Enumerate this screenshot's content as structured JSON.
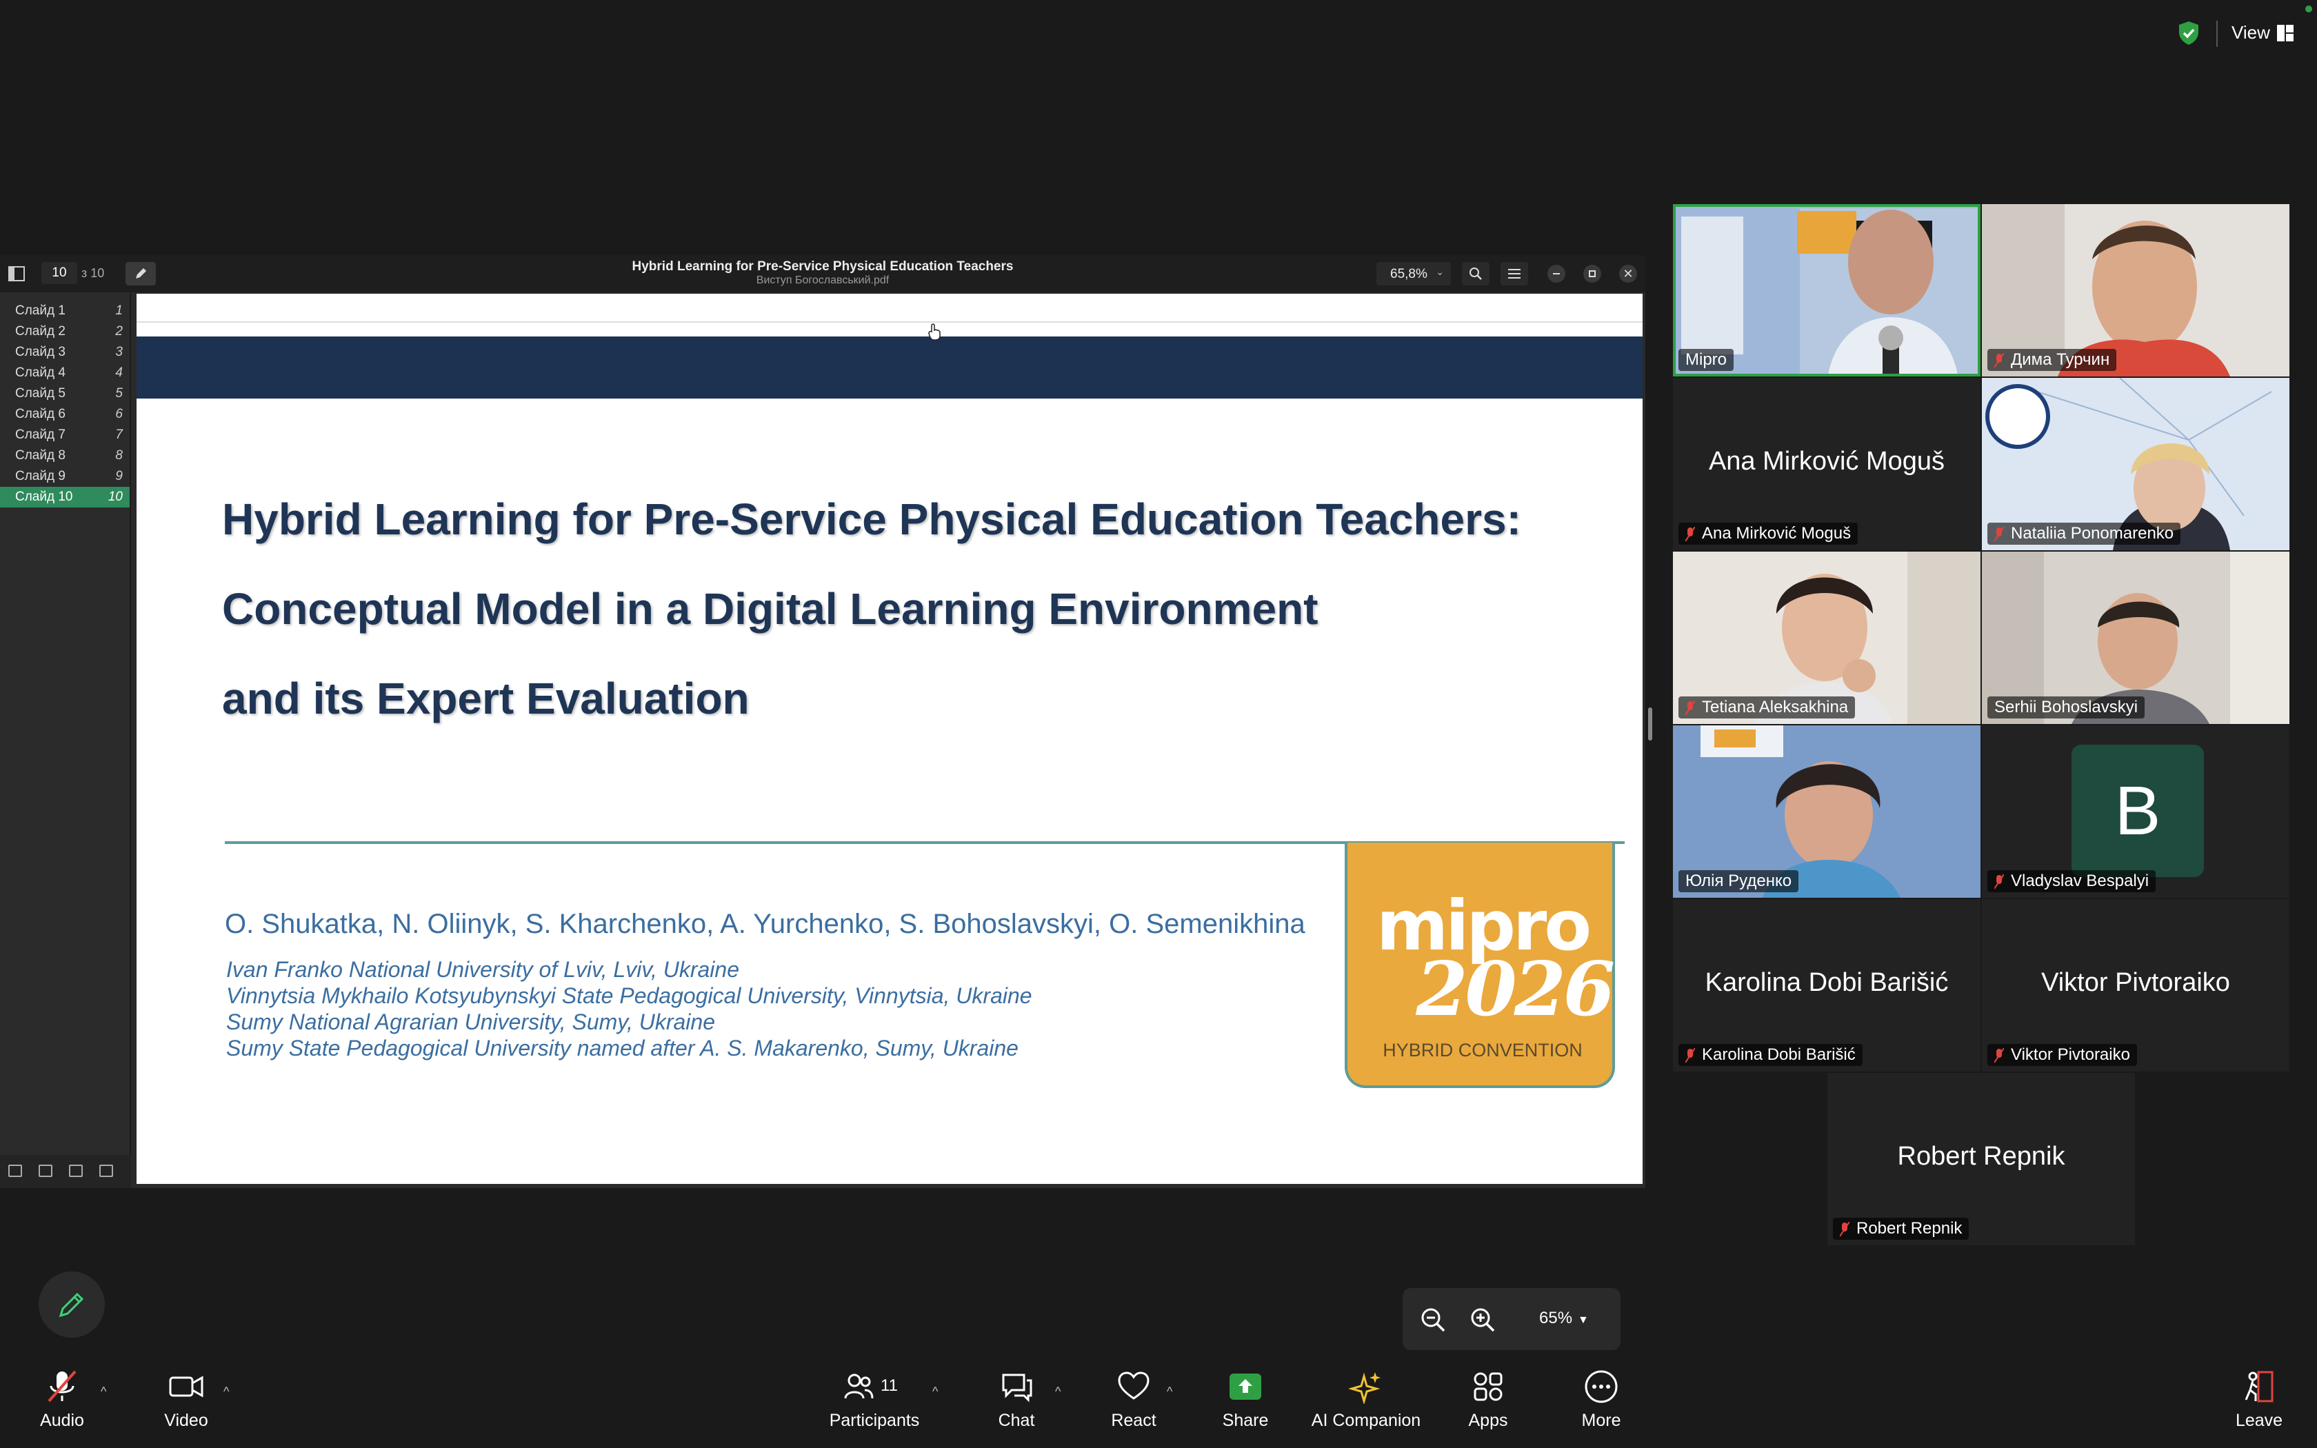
{
  "top_right": {
    "view_label": "View"
  },
  "pdf_viewer": {
    "page_current": "10",
    "page_total": "з 10",
    "title": "Hybrid Learning for Pre-Service Physical Education Teachers",
    "filename": "Виступ Богославський.pdf",
    "zoom": "65,8%",
    "slides": [
      {
        "label": "Слайд 1",
        "num": "1"
      },
      {
        "label": "Слайд 2",
        "num": "2"
      },
      {
        "label": "Слайд 3",
        "num": "3"
      },
      {
        "label": "Слайд 4",
        "num": "4"
      },
      {
        "label": "Слайд 5",
        "num": "5"
      },
      {
        "label": "Слайд 6",
        "num": "6"
      },
      {
        "label": "Слайд 7",
        "num": "7"
      },
      {
        "label": "Слайд 8",
        "num": "8"
      },
      {
        "label": "Слайд 9",
        "num": "9"
      },
      {
        "label": "Слайд 10",
        "num": "10"
      }
    ]
  },
  "slide": {
    "title_lines": [
      "Hybrid Learning for Pre-Service Physical Education Teachers:",
      "Conceptual Model in a Digital Learning Environment",
      "and its Expert Evaluation"
    ],
    "authors": "O. Shukatka, N. Oliinyk, S. Kharchenko, A. Yurchenko, S. Bohoslavskyi, O. Semenikhina",
    "affiliations": [
      "Ivan Franko National University of Lviv, Lviv, Ukraine",
      "Vinnytsia Mykhailo Kotsyubynskyi State Pedagogical University, Vinnytsia, Ukraine",
      "Sumy National Agrarian University, Sumy, Ukraine",
      "Sumy State Pedagogical University named after A. S. Makarenko, Sumy, Ukraine"
    ],
    "logo": {
      "line1": "mipro",
      "line2": "2026",
      "line3": "HYBRID CONVENTION"
    }
  },
  "participants": [
    {
      "name": "Mipro",
      "muted": false,
      "video": true
    },
    {
      "name": "Дима Турчин",
      "muted": true,
      "video": true
    },
    {
      "name": "Ana Mirković Moguš",
      "display": "Ana Mirković Moguš",
      "muted": true,
      "video": false
    },
    {
      "name": "Nataliia Ponomarenko",
      "muted": true,
      "video": true
    },
    {
      "name": "Tetiana Aleksakhina",
      "muted": true,
      "video": true
    },
    {
      "name": "Serhii Bohoslavskyi",
      "muted": false,
      "video": true
    },
    {
      "name": "Юлія Руденко",
      "muted": false,
      "video": true
    },
    {
      "name": "Vladyslav Bespalyi",
      "avatar_letter": "B",
      "muted": true,
      "video": false
    },
    {
      "name": "Karolina Dobi Barišić",
      "display": "Karolina Dobi Barišić",
      "muted": true,
      "video": false
    },
    {
      "name": "Viktor Pivtoraiko",
      "display": "Viktor Pivtoraiko",
      "muted": true,
      "video": false
    },
    {
      "name": "Robert Repnik",
      "display": "Robert Repnik",
      "muted": true,
      "video": false
    }
  ],
  "share_zoom": {
    "value": "65%"
  },
  "toolbar": {
    "audio": "Audio",
    "video": "Video",
    "participants": "Participants",
    "participants_count": "11",
    "chat": "Chat",
    "react": "React",
    "share": "Share",
    "ai_companion": "AI Companion",
    "apps": "Apps",
    "more": "More",
    "leave": "Leave"
  },
  "colors": {
    "accent_green": "#2ea043",
    "slide_navy": "#1c3250",
    "logo_orange": "#eaa93d",
    "mute_red": "#e0443e"
  }
}
